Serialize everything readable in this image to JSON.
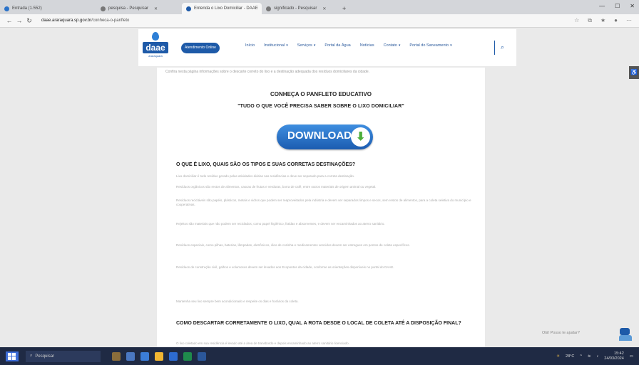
{
  "browser": {
    "tabs": [
      {
        "label": "Entrada (1.552)",
        "active": false
      },
      {
        "label": "pesquisa - Pesquisar",
        "active": false
      },
      {
        "label": "Entenda o Lixo Domiciliar - DAAE",
        "active": true
      },
      {
        "label": "significado - Pesquisar",
        "active": false
      }
    ],
    "new_tab": "+",
    "window_controls": [
      "—",
      "☐",
      "✕"
    ],
    "url_host": "daae.araraquara.sp.gov.br",
    "url_path": "/conheca-o-panfleto"
  },
  "header": {
    "logo_text": "daae",
    "logo_sub": "araraquara",
    "atendimento_button": "Atendimento Online",
    "menu": [
      {
        "label": "Início",
        "has_dropdown": false
      },
      {
        "label": "Institucional",
        "has_dropdown": true
      },
      {
        "label": "Serviços",
        "has_dropdown": true
      },
      {
        "label": "Portal da Água",
        "has_dropdown": false
      },
      {
        "label": "Notícias",
        "has_dropdown": false
      },
      {
        "label": "Contato",
        "has_dropdown": true
      },
      {
        "label": "Portal do Saneamento",
        "has_dropdown": true
      }
    ]
  },
  "article": {
    "intro": "Confira nesta página informações sobre o descarte correto do lixo e a destinação adequada dos resíduos domiciliares da cidade.",
    "heading1": "CONHEÇA O PANFLETO EDUCATIVO",
    "heading2": "\"TUDO O QUE VOCÊ PRECISA SABER SOBRE O LIXO DOMICILIAR\"",
    "download_label": "DOWNLOAD",
    "section1_title": "O QUE É LIXO, QUAIS SÃO OS TIPOS E SUAS CORRETAS DESTINAÇÕES?",
    "paragraphs": [
      "Lixo domiciliar é todo resíduo gerado pelas atividades diárias nas residências e deve ser separado para a correta destinação.",
      "Resíduos orgânicos são restos de alimentos, cascas de frutas e verduras, borra de café, entre outros materiais de origem animal ou vegetal.",
      "Resíduos recicláveis são papéis, plásticos, metais e vidros que podem ser reaproveitados pela indústria e devem ser separados limpos e secos, sem restos de alimentos, para a coleta seletiva do município e cooperativas.",
      "Rejeitos são materiais que não podem ser reciclados, como papel higiênico, fraldas e absorventes, e devem ser encaminhados ao aterro sanitário.",
      "Resíduos especiais, como pilhas, baterias, lâmpadas, eletrônicos, óleo de cozinha e medicamentos vencidos devem ser entregues em pontos de coleta específicos.",
      "Resíduos de construção civil, galhos e volumosos devem ser levados aos Ecopontos da cidade, conforme as orientações disponíveis no portal do DAAE.",
      "Mantenha seu lixo sempre bem acondicionado e respeite os dias e horários da coleta."
    ],
    "section2_title": "COMO DESCARTAR CORRETAMENTE O LIXO, QUAL A ROTA DESDE O LOCAL DE COLETA ATÉ A DISPOSIÇÃO FINAL?",
    "last_line": "O lixo coletado em sua residência é levado até a área de transbordo e depois encaminhado ao aterro sanitário licenciado."
  },
  "floating": {
    "chat_text": "Olá! Posso te ajudar?"
  },
  "taskbar": {
    "search_placeholder": "Pesquisar",
    "weather": "28°C",
    "time": "15:42",
    "date": "24/03/2024"
  }
}
